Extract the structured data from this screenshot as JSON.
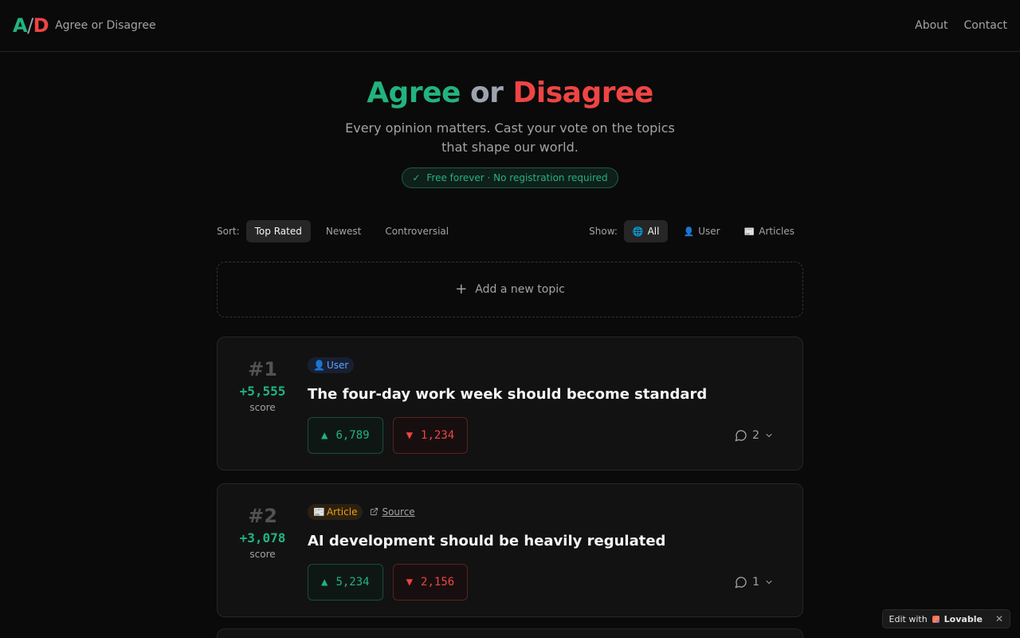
{
  "header": {
    "logo_a": "A",
    "logo_slash": "/",
    "logo_d": "D",
    "brand_name": "Agree or Disagree",
    "nav": [
      "About",
      "Contact"
    ]
  },
  "hero": {
    "title_agree": "Agree",
    "title_or": "or",
    "title_disagree": "Disagree",
    "tagline": "Every opinion matters. Cast your vote on the topics that shape our world.",
    "pill_check": "✓",
    "pill_text": "Free forever · No registration required"
  },
  "controls": {
    "sort_label": "Sort:",
    "sort_options": [
      "Top Rated",
      "Newest",
      "Controversial"
    ],
    "sort_selected": "Top Rated",
    "show_label": "Show:",
    "show_options": [
      {
        "icon": "globe-icon",
        "glyph": "🌐",
        "label": "All"
      },
      {
        "icon": "user-icon",
        "glyph": "👤",
        "label": "User"
      },
      {
        "icon": "newspaper-icon",
        "glyph": "📰",
        "label": "Articles"
      }
    ],
    "show_selected": "All"
  },
  "add_topic": {
    "plus": "+",
    "label": "Add a new topic"
  },
  "topics": [
    {
      "rank": "#1",
      "score": "+5,555",
      "score_label": "score",
      "badge_glyph": "👤",
      "badge": "User",
      "source": "",
      "title": "The four-day work week should become standard",
      "agree_glyph": "▲",
      "agree": "6,789",
      "disagree_glyph": "▼",
      "disagree": "1,234",
      "comments": "2"
    },
    {
      "rank": "#2",
      "score": "+3,078",
      "score_label": "score",
      "badge_glyph": "📰",
      "badge": "Article",
      "source": "Source",
      "title": "AI development should be heavily regulated",
      "agree_glyph": "▲",
      "agree": "5,234",
      "disagree_glyph": "▼",
      "disagree": "2,156",
      "comments": "1"
    }
  ],
  "lovable": {
    "edit_with": "Edit with",
    "brand": "Lovable",
    "close": "✕"
  },
  "colors": {
    "agree": "#22b37f",
    "disagree": "#ef4444",
    "background": "#0a0a0a",
    "card": "#121212"
  }
}
